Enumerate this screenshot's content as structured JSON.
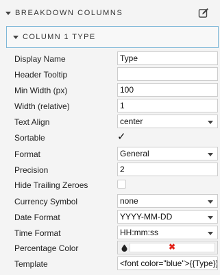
{
  "header": {
    "title": "BREAKDOWN COLUMNS",
    "edit_icon": "edit-icon"
  },
  "subheader": {
    "title": "COLUMN 1 TYPE"
  },
  "fields": {
    "display_name": {
      "label": "Display Name",
      "value": "Type"
    },
    "header_tooltip": {
      "label": "Header Tooltip",
      "value": ""
    },
    "min_width": {
      "label": "Min Width (px)",
      "value": "100"
    },
    "width_relative": {
      "label": "Width (relative)",
      "value": "1"
    },
    "text_align": {
      "label": "Text Align",
      "value": "center"
    },
    "sortable": {
      "label": "Sortable",
      "checked": true,
      "mark": "✓"
    },
    "format": {
      "label": "Format",
      "value": "General"
    },
    "precision": {
      "label": "Precision",
      "value": "2"
    },
    "hide_trailing_zeroes": {
      "label": "Hide Trailing Zeroes",
      "checked": false
    },
    "currency_symbol": {
      "label": "Currency Symbol",
      "value": "none"
    },
    "date_format": {
      "label": "Date Format",
      "value": "YYYY-MM-DD"
    },
    "time_format": {
      "label": "Time Format",
      "value": "HH:mm:ss"
    },
    "percentage_color": {
      "label": "Percentage Color",
      "value_mark": "✖",
      "value_color": "#e2231a"
    },
    "template": {
      "label": "Template",
      "value": "<font color=\"blue\">{{Type}}"
    }
  }
}
